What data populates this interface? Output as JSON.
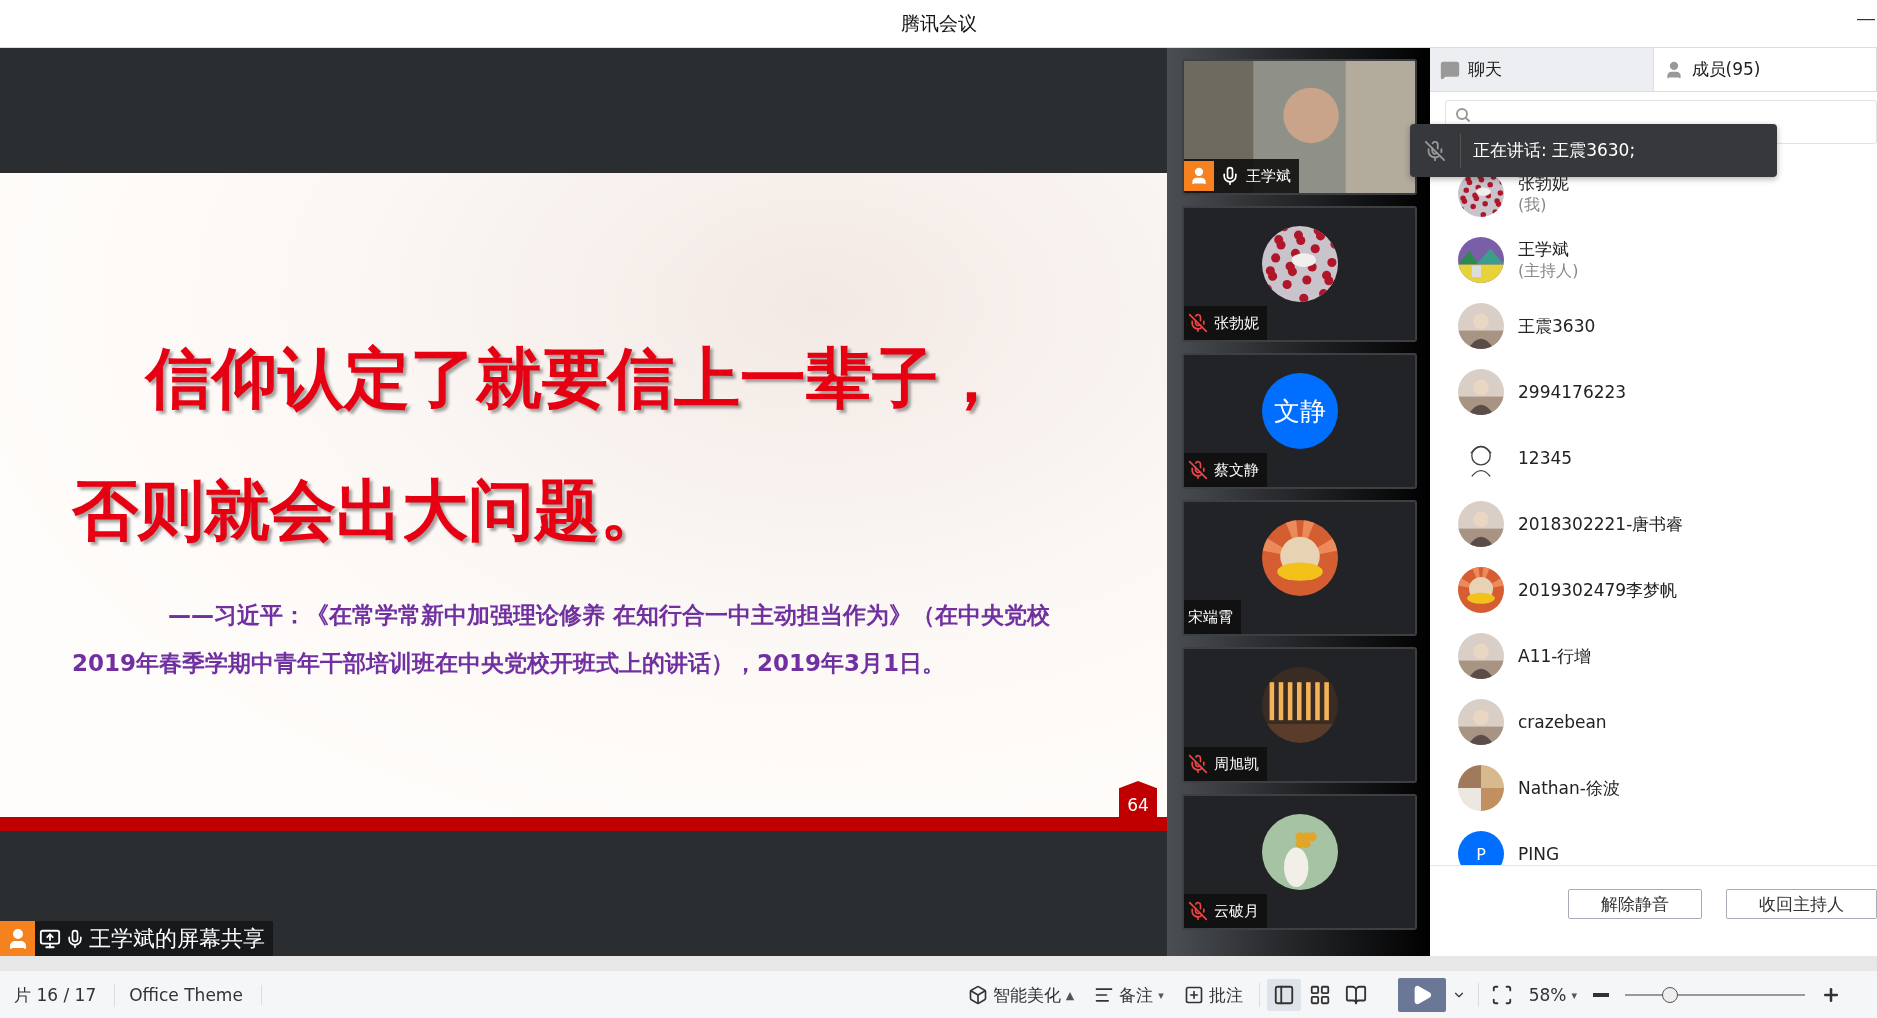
{
  "window": {
    "title": "腾讯会议",
    "minimize": "—"
  },
  "slide": {
    "headline": [
      "信仰认定了就要信上一辈子，",
      "否则就会出大问题。"
    ],
    "quote": "——习近平：《在常学常新中加强理论修养  在知行合一中主动担当作为》（在中央党校2019年春季学期中青年干部培训班在中央党校开班式上的讲话），2019年3月1日。",
    "page": "64"
  },
  "share_label": {
    "text": "王学斌的屏幕共享"
  },
  "video_tiles": [
    {
      "kind": "video",
      "name": "王学斌",
      "host": true,
      "muted": false
    },
    {
      "kind": "picture",
      "name": "张勃妮",
      "muted": true
    },
    {
      "kind": "initial",
      "initials": "文静",
      "name": "蔡文静",
      "muted": true
    },
    {
      "kind": "picture",
      "name": "宋端霄"
    },
    {
      "kind": "picture",
      "name": "周旭凯",
      "muted": true
    },
    {
      "kind": "picture",
      "name": "云破月",
      "muted": true
    }
  ],
  "tabs": [
    {
      "label": "聊天",
      "selected": true
    },
    {
      "label": "成员(95)",
      "selected": false
    }
  ],
  "speaking_tooltip": {
    "text": "正在讲话: 王震3630;"
  },
  "members": [
    {
      "name": "张勃妮",
      "role": "(我)",
      "kind": "picture"
    },
    {
      "name": "王学斌",
      "role": "(主持人)",
      "kind": "picture"
    },
    {
      "name": "王震3630",
      "kind": "picture"
    },
    {
      "name": "2994176223",
      "kind": "picture"
    },
    {
      "name": "12345",
      "kind": "picture"
    },
    {
      "name": "2018302221-唐书睿",
      "kind": "picture"
    },
    {
      "name": "2019302479李梦帆",
      "kind": "picture"
    },
    {
      "name": "A11-行增",
      "kind": "picture"
    },
    {
      "name": "crazebean",
      "kind": "picture"
    },
    {
      "name": "Nathan-徐波",
      "kind": "picture"
    },
    {
      "name": "PING",
      "kind": "initial",
      "initial": "P"
    }
  ],
  "member_buttons": [
    "解除静音",
    "收回主持人"
  ],
  "status_bar": {
    "slide_counter": "片 16 / 17",
    "theme": "Office Theme",
    "tools": [
      {
        "kind": "beautify",
        "label": "智能美化",
        "caret": "▲"
      },
      {
        "kind": "notes",
        "label": "备注",
        "caret": "▾"
      },
      {
        "kind": "comment",
        "label": "批注"
      }
    ],
    "views": [
      {
        "kind": "normal",
        "selected": true
      },
      {
        "kind": "sorter",
        "selected": false
      },
      {
        "kind": "reading",
        "selected": false
      }
    ],
    "zoom": "58%",
    "zoom_caret": "▾",
    "zoom_slider": {
      "level": 0.25
    }
  }
}
